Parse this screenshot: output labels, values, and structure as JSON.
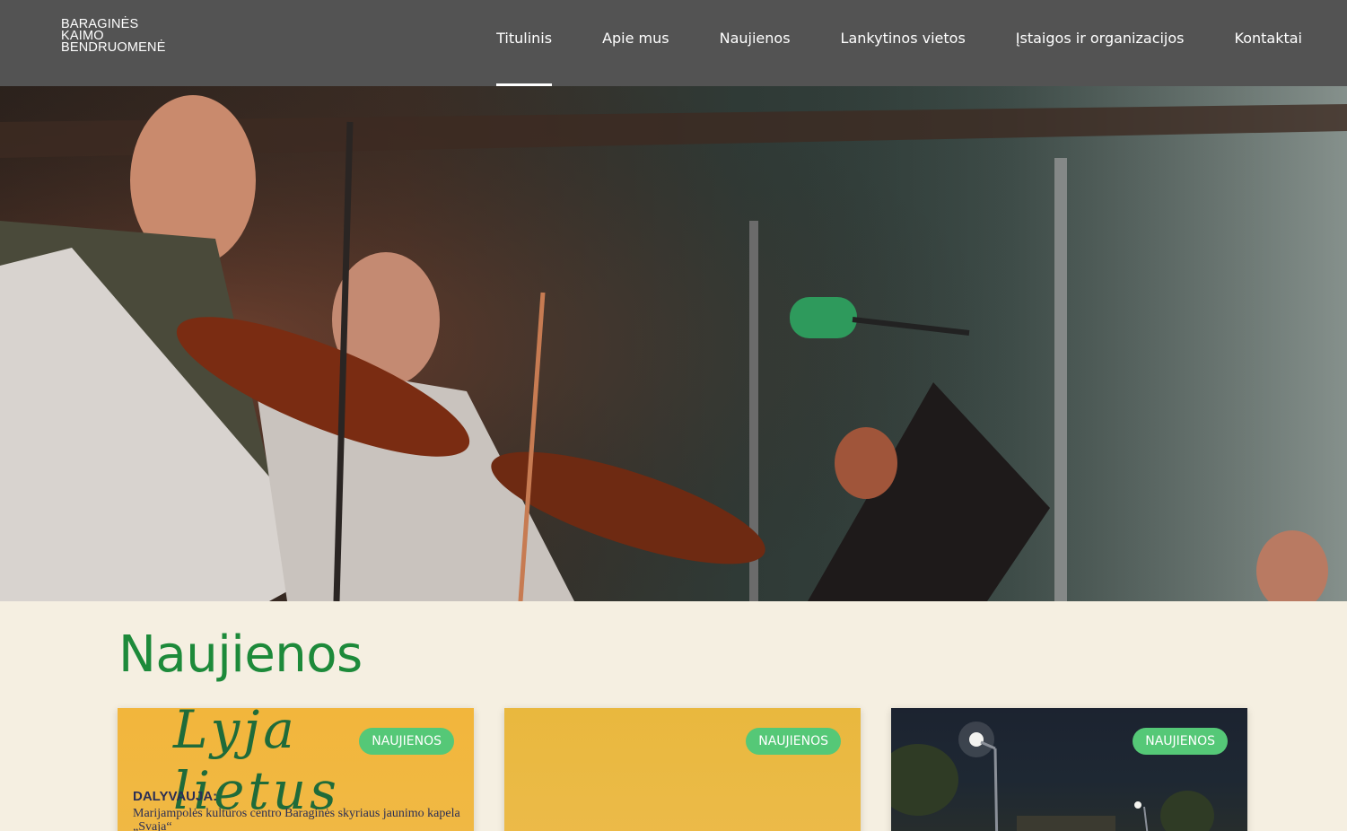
{
  "header": {
    "logo_lines": [
      "BARAGINĖS",
      "KAIMO",
      "BENDRUOMENĖ"
    ],
    "nav": [
      {
        "label": "Titulinis",
        "active": true
      },
      {
        "label": "Apie mus",
        "active": false
      },
      {
        "label": "Naujienos",
        "active": false
      },
      {
        "label": "Lankytinos vietos",
        "active": false
      },
      {
        "label": "Įstaigos ir organizacijos",
        "active": false
      },
      {
        "label": "Kontaktai",
        "active": false
      }
    ]
  },
  "hero": {
    "image": "stage-violin-performance-photo"
  },
  "news": {
    "title": "Naujienos",
    "cards": [
      {
        "badge": "NAUJIENOS",
        "poster_script": "Lyja lietus",
        "poster_heading": "DALYVAUJA:",
        "poster_text": "Marijampolės kultūros centro Baraginės skyriaus jaunimo kapela „Svaja“"
      },
      {
        "badge": "NAUJIENOS"
      },
      {
        "badge": "NAUJIENOS"
      }
    ]
  },
  "colors": {
    "header_bg": "#535353",
    "page_bg": "#f5efe1",
    "title_green": "#1d8a3a",
    "badge_green": "#55c877"
  }
}
